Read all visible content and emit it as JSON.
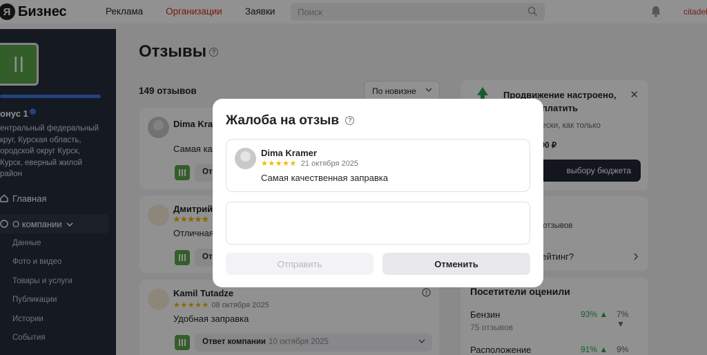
{
  "header": {
    "logo_letter": "Я",
    "logo_text": "Бизнес",
    "nav": [
      "Реклама",
      "Организации",
      "Заявки"
    ],
    "nav_active_index": 1,
    "search_placeholder": "Поиск",
    "user": "citadel"
  },
  "sidebar": {
    "org_name": "онус 1",
    "org_address": "ентральный федеральный круг, Курская область, ородской округ Курск, Курск, еверный жилой район",
    "items": {
      "main": "Главная",
      "about": "О компании"
    },
    "sub_items": [
      "Данные",
      "Фото и видео",
      "Товары и услуги",
      "Публикации",
      "Истории",
      "События"
    ]
  },
  "main": {
    "title": "Отзывы",
    "count": "149 отзывов",
    "sort": "По новизне",
    "reviews": [
      {
        "name": "Dima Kra",
        "stars": "★★★★★",
        "text": "Самая кач",
        "reply_label": "Отв"
      },
      {
        "name": "Дмитрий",
        "stars": "★★★★★",
        "text": "Отличная",
        "reply_label": "От"
      },
      {
        "name": "Kamil Tutadze",
        "stars": "★★★★★",
        "date": "08 октября 2025",
        "text": "Удобная заправка",
        "reply_label": "Ответ компании",
        "reply_date": "10 октября 2025"
      }
    ]
  },
  "right": {
    "promo_title": "Продвижение настроено, только оплатить",
    "promo_text": "автоматически, как только",
    "promo_budget": "жет — 9 900 ₽",
    "promo_button": "выбору бюджета",
    "rating_stars": "★",
    "rating_text": "х отзывов",
    "rating_link": "рейтинг?",
    "visitors_title": "Посетители оценили",
    "visitors": [
      {
        "label": "Бензин",
        "sub": "75 отзывов",
        "pos": "93%",
        "neg": "7%"
      },
      {
        "label": "Расположение",
        "sub": "",
        "pos": "91%",
        "neg": "9%"
      }
    ]
  },
  "modal": {
    "title": "Жалоба на отзыв",
    "review": {
      "name": "Dima Kramer",
      "stars": "★★★★★",
      "date": "21 октября 2025",
      "text": "Самая качественная заправка"
    },
    "textarea_value": "",
    "submit_label": "Отправить",
    "cancel_label": "Отменить"
  },
  "colors": {
    "accent_red": "#d12b1c",
    "star": "#f5b800",
    "positive": "#2ea44f",
    "sidebar_bg": "#262c3a",
    "progress": "#3f77e0"
  },
  "progress_fraction": 1.0
}
